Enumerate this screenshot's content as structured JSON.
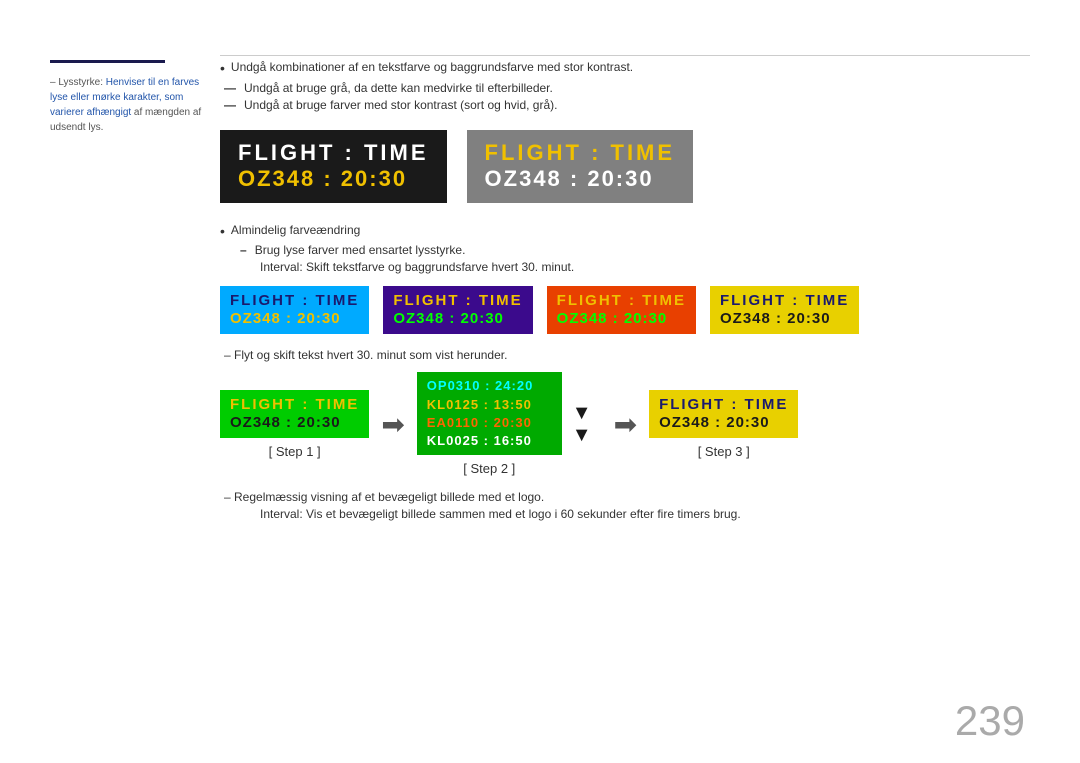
{
  "page": {
    "number": "239"
  },
  "sidebar": {
    "rule_color": "#1a1a4e",
    "text_prefix": "–  Lysstyrke:",
    "text_highlight": "Henviser til en farves lyse eller mørke karakter, som varierer afhængigt",
    "text_suffix": " af mængden af udsendt lys."
  },
  "bullets": {
    "main_bullet": "Undgå kombinationer af en tekstfarve og baggrundsfarve med stor kontrast.",
    "dash1": "Undgå at bruge grå, da dette kan medvirke til efterbilleder.",
    "dash2": "Undgå at bruge farver med stor kontrast (sort og hvid, grå)."
  },
  "large_displays": {
    "dark": {
      "row1": "FLIGHT  :  TIME",
      "row2": "OZ348  :  20:30"
    },
    "gray": {
      "row1": "FLIGHT  :  TIME",
      "row2": "OZ348  :  20:30"
    }
  },
  "section2_bullets": {
    "main": "Almindelig farveændring",
    "sub1": "Brug lyse farver med ensartet lysstyrke.",
    "sub2": "Interval: Skift tekstfarve og baggrundsfarve hvert 30. minut."
  },
  "small_displays": {
    "cyan": {
      "row1": "FLIGHT  :  TIME",
      "row2": "OZ348  :  20:30"
    },
    "purple": {
      "row1": "FLIGHT  :  TIME",
      "row2": "OZ348  :  20:30"
    },
    "orange": {
      "row1": "FLIGHT  :  TIME",
      "row2": "OZ348  :  20:30"
    },
    "yellow": {
      "row1": "FLIGHT  :  TIME",
      "row2": "OZ348  :  20:30"
    }
  },
  "section3_dash": "–  Flyt og skift tekst hvert 30. minut som vist herunder.",
  "steps": {
    "step1": {
      "label": "[ Step 1 ]",
      "row1": "FLIGHT  :  TIME",
      "row2": "OZ348  :  20:30"
    },
    "step2": {
      "label": "[ Step 2 ]",
      "lines": [
        {
          "text": "OP0310  :  24:20",
          "color": "cyan"
        },
        {
          "text": "KL0125  :  13:50",
          "color": "yellow"
        },
        {
          "text": "EA0110  :  20:30",
          "color": "orange"
        },
        {
          "text": "KL0025  :  16:50",
          "color": "white"
        }
      ]
    },
    "step3": {
      "label": "[ Step 3 ]",
      "row1": "FLIGHT  :  TIME",
      "row2": "OZ348  :  20:30"
    }
  },
  "section4_bullets": {
    "main": "–  Regelmæssig visning af et bevægeligt billede med et logo.",
    "sub": "Interval: Vis et bevægeligt billede sammen med et logo i 60 sekunder efter fire timers brug."
  }
}
